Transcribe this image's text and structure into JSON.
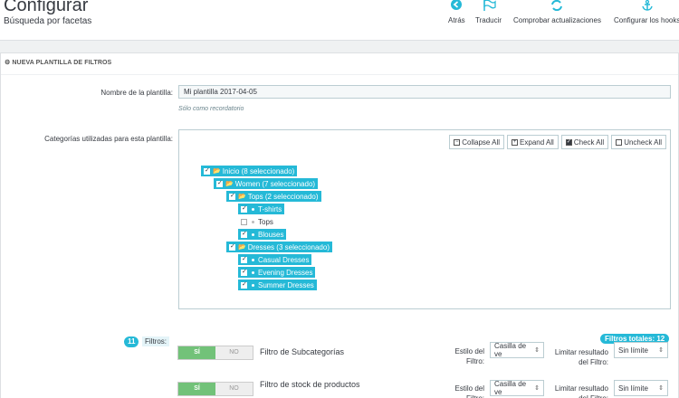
{
  "header": {
    "title": "Configurar",
    "subtitle": "Búsqueda por facetas",
    "toolbar": [
      {
        "label": "Atrás",
        "icon": "back-circle-icon"
      },
      {
        "label": "Traducir",
        "icon": "flag-icon"
      },
      {
        "label": "Comprobar actualizaciones",
        "icon": "refresh-icon"
      },
      {
        "label": "Configurar los hooks",
        "icon": "anchor-icon"
      }
    ]
  },
  "panel": {
    "heading": "NUEVA PLANTILLA DE FILTROS",
    "template_name_label": "Nombre de la plantilla:",
    "template_name_value": "Mi plantilla 2017-04-05",
    "template_name_help": "Sólo como recordatorio",
    "categories_label": "Categorías utilizadas para esta plantilla:",
    "tree_buttons": {
      "collapse": "Collapse All",
      "expand": "Expand All",
      "check": "Check All",
      "uncheck": "Uncheck All"
    },
    "tree": [
      {
        "label": "Inicio (8 seleccionado)",
        "checked": true
      },
      {
        "label": "Women (7 seleccionado)",
        "checked": true
      },
      {
        "label": "Tops (2 seleccionado)",
        "checked": true
      },
      {
        "label": "T-shirts",
        "checked": true
      },
      {
        "label": "Tops",
        "checked": false
      },
      {
        "label": "Blouses",
        "checked": true
      },
      {
        "label": "Dresses (3 seleccionado)",
        "checked": true
      },
      {
        "label": "Casual Dresses",
        "checked": true
      },
      {
        "label": "Evening Dresses",
        "checked": true
      },
      {
        "label": "Summer Dresses",
        "checked": true
      }
    ]
  },
  "filters": {
    "count": "11",
    "label": "Filtros:",
    "total": "Filtros totales: 12",
    "switch_on": "SÍ",
    "switch_off": "NO",
    "style_label": "Estilo del Filtro:",
    "limit_label": "Limitar resultado del Filtro:",
    "items": [
      {
        "name": "Filtro de Subcategorías",
        "style": "Casilla de ve",
        "limit": "Sin límite"
      },
      {
        "name": "Filtro de stock de productos",
        "style": "Casilla de ve",
        "limit": "Sin límite"
      }
    ]
  },
  "colors": {
    "accent": "#25b9d7",
    "switch_on": "#72c279"
  }
}
